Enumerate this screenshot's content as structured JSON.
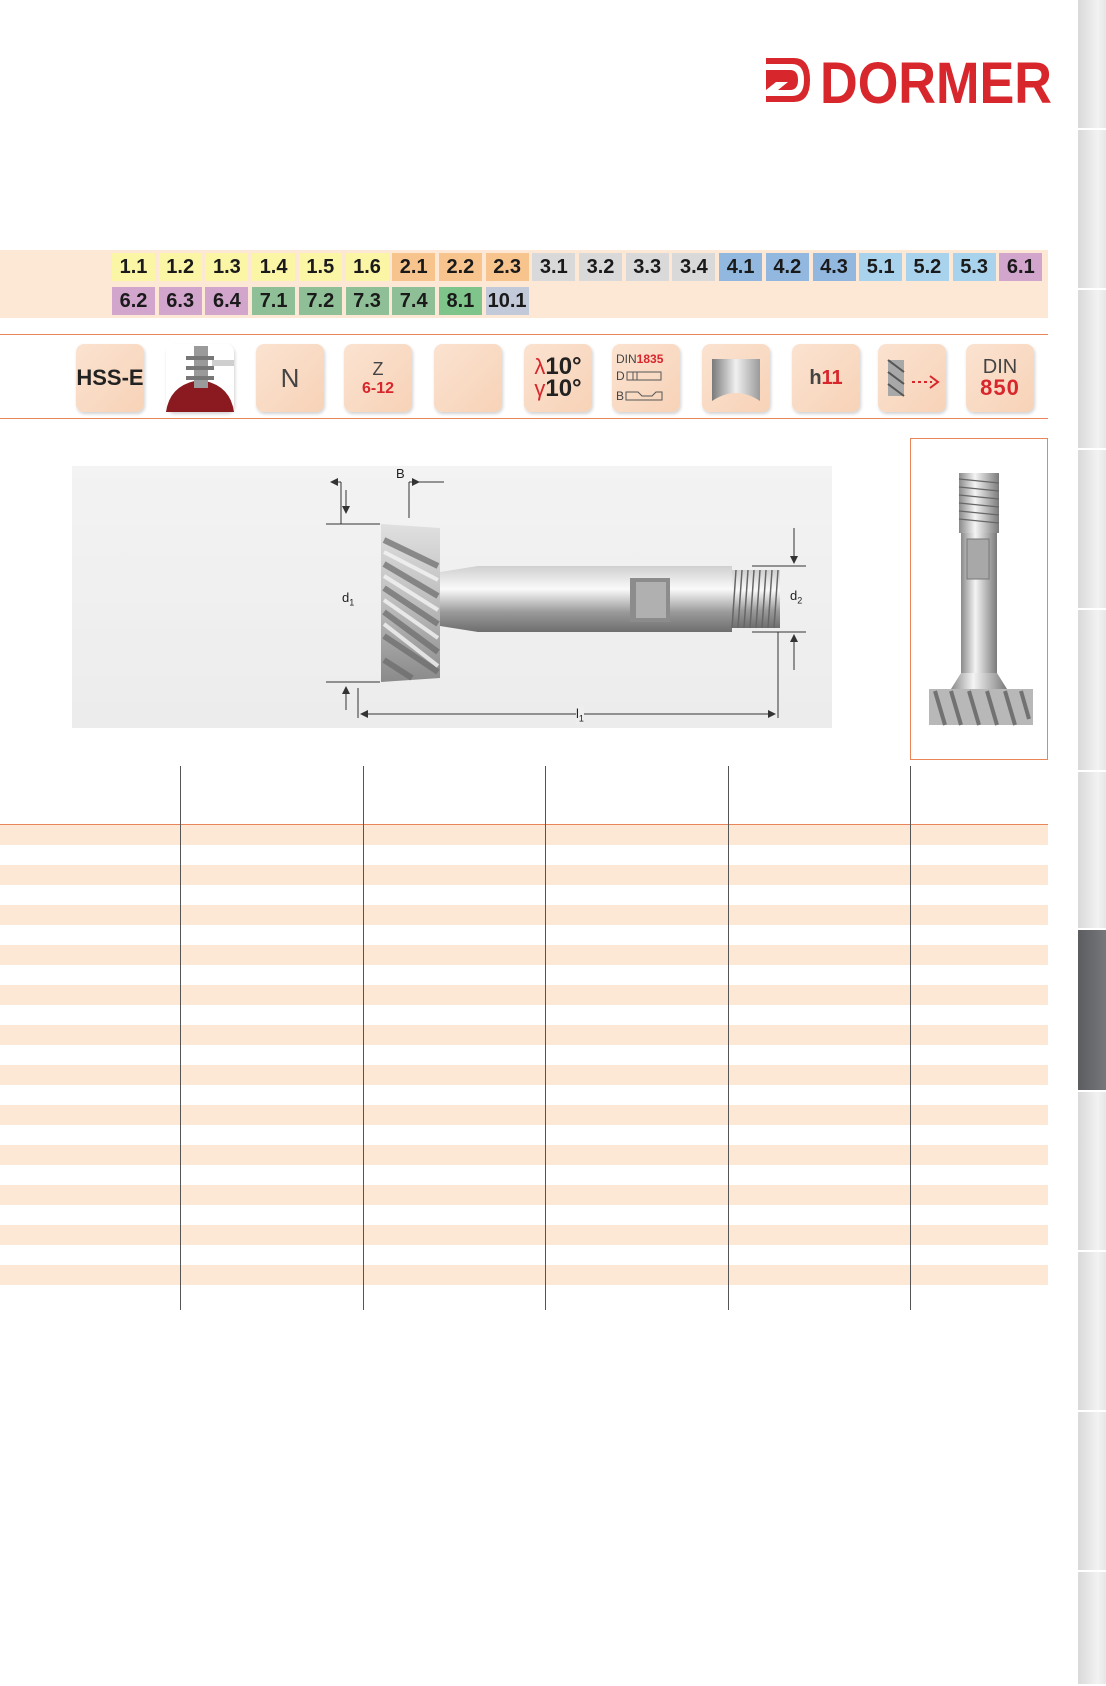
{
  "brand": {
    "name": "DORMER",
    "color": "#d7262c"
  },
  "materials": {
    "row1": [
      {
        "code": "1.1",
        "color": "#fbf5a6"
      },
      {
        "code": "1.2",
        "color": "#fbf5a6"
      },
      {
        "code": "1.3",
        "color": "#fbf5a6"
      },
      {
        "code": "1.4",
        "color": "#fbf5a6"
      },
      {
        "code": "1.5",
        "color": "#fbf5a6"
      },
      {
        "code": "1.6",
        "color": "#fbf5a6"
      },
      {
        "code": "2.1",
        "color": "#f7c48e"
      },
      {
        "code": "2.2",
        "color": "#f7c48e"
      },
      {
        "code": "2.3",
        "color": "#f7c48e"
      },
      {
        "code": "3.1",
        "color": "#d9d9d9"
      },
      {
        "code": "3.2",
        "color": "#d9d9d9"
      },
      {
        "code": "3.3",
        "color": "#d9d9d9"
      },
      {
        "code": "3.4",
        "color": "#d9d9d9"
      },
      {
        "code": "4.1",
        "color": "#92b8e0"
      },
      {
        "code": "4.2",
        "color": "#92b8e0"
      },
      {
        "code": "4.3",
        "color": "#92b8e0"
      },
      {
        "code": "5.1",
        "color": "#a9d3ec"
      },
      {
        "code": "5.2",
        "color": "#a9d3ec"
      },
      {
        "code": "5.3",
        "color": "#a9d3ec"
      },
      {
        "code": "6.1",
        "color": "#d1a5cc"
      }
    ],
    "row2": [
      {
        "code": "6.2",
        "color": "#d1a5cc"
      },
      {
        "code": "6.3",
        "color": "#d1a5cc"
      },
      {
        "code": "6.4",
        "color": "#d1a5cc"
      },
      {
        "code": "7.1",
        "color": "#8fbf96"
      },
      {
        "code": "7.2",
        "color": "#8fbf96"
      },
      {
        "code": "7.3",
        "color": "#8fbf96"
      },
      {
        "code": "7.4",
        "color": "#8fbf96"
      },
      {
        "code": "8.1",
        "color": "#7fc48a"
      },
      {
        "code": "10.1",
        "color": "#c2c9d9"
      }
    ]
  },
  "icons": {
    "material": "HSS-E",
    "type": "N",
    "teeth_label": "Z",
    "teeth_range": "6-12",
    "lambda": "λ",
    "lambda_value": "10°",
    "gamma": "γ",
    "gamma_value": "10°",
    "din_small": "DIN",
    "din_small_num": "1835",
    "din_d": "D",
    "din_b": "B",
    "tolerance_prefix": "h",
    "tolerance_value": "11",
    "standard_label": "DIN",
    "standard_number": "850",
    "accent_color": "#d7262c"
  },
  "drawing": {
    "label_b": "B",
    "label_d1": "d",
    "label_d1_sub": "1",
    "label_d2": "d",
    "label_d2_sub": "2",
    "label_l1": "l",
    "label_l1_sub": "1"
  },
  "table": {
    "columns": 6,
    "row_count": 24
  }
}
